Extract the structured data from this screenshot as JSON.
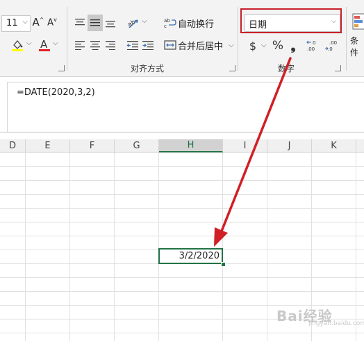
{
  "ribbon": {
    "font_size": "11",
    "font_size_caret": "⌵",
    "grow_font_glyph": "A",
    "shrink_font_glyph": "A",
    "fill_color_caret": "⌵",
    "font_color_glyph": "A",
    "font_color_caret": "⌵",
    "orientation_caret": "⌵",
    "wrap_text_label": "自动换行",
    "merge_center_label": "合并后居中",
    "merge_center_caret": "⌵",
    "alignment_group_label": "对齐方式",
    "number_format_value": "日期",
    "number_format_caret": "⌵",
    "currency_glyph": "$",
    "currency_caret": "⌵",
    "percent_glyph": "%",
    "comma_glyph": "❟",
    "number_group_label": "数字",
    "conditional_label": "条件",
    "accent_color": "#217346",
    "highlight_color": "#c8202a",
    "font_color_bar": "#e02020",
    "fill_color_bar": "#ffff00"
  },
  "formula_bar": {
    "content": "=DATE(2020,3,2)"
  },
  "sheet": {
    "column_headers": [
      "D",
      "E",
      "F",
      "G",
      "H",
      "I",
      "J",
      "K"
    ],
    "selected_column": "H",
    "active_cell_value": "3/2/2020"
  },
  "watermark": {
    "text": "Bai经验",
    "subtext": "jingyan.baidu.com"
  },
  "icons": {
    "align_top": "align-top-icon",
    "align_middle": "align-middle-icon",
    "align_bottom": "align-bottom-icon",
    "orientation": "text-orientation-icon",
    "align_left": "align-left-icon",
    "align_center": "align-center-icon",
    "align_right": "align-right-icon",
    "decrease_indent": "decrease-indent-icon",
    "increase_indent": "increase-indent-icon",
    "wrap": "wrap-text-icon",
    "merge": "merge-center-icon",
    "increase_decimal": "increase-decimal-icon",
    "decrease_decimal": "decrease-decimal-icon",
    "annotation_arrow": "red-arrow-icon"
  }
}
